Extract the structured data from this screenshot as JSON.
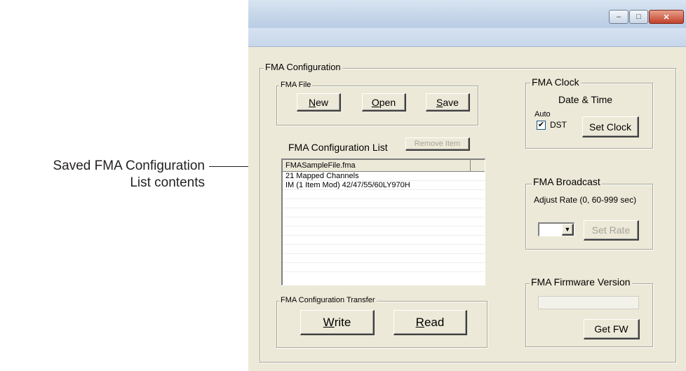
{
  "callout": {
    "line1": "Saved FMA Configuration",
    "line2": "List contents"
  },
  "window": {
    "controls": {
      "minimize": "–",
      "maximize": "□",
      "close": "✕"
    }
  },
  "config": {
    "group_title": "FMA Configuration",
    "file": {
      "title": "FMA File",
      "new_underline": "N",
      "new_rest": "ew",
      "open_underline": "O",
      "open_rest": "pen",
      "save_underline": "S",
      "save_rest": "ave"
    },
    "list": {
      "title": "FMA Configuration List",
      "remove_button": "Remove Item",
      "header": "FMASampleFile.fma",
      "rows": [
        "21 Mapped Channels",
        "IM (1 Item Mod) 42/47/55/60LY970H",
        "",
        "",
        "",
        "",
        "",
        "",
        "",
        "",
        ""
      ]
    },
    "transfer": {
      "title": "FMA Configuration Transfer",
      "write_underline": "W",
      "write_rest": "rite",
      "read_underline": "R",
      "read_rest": "ead"
    },
    "clock": {
      "title": "FMA Clock",
      "subtitle": "Date & Time",
      "auto_label": "Auto",
      "dst_label": "DST",
      "dst_checked": true,
      "set_button": "Set Clock"
    },
    "broadcast": {
      "title": "FMA Broadcast",
      "adjust_label": "Adjust Rate (0, 60-999 sec)",
      "rate_value": "",
      "set_button": "Set Rate"
    },
    "firmware": {
      "title": "FMA Firmware Version",
      "value": "",
      "get_button": "Get FW"
    }
  }
}
